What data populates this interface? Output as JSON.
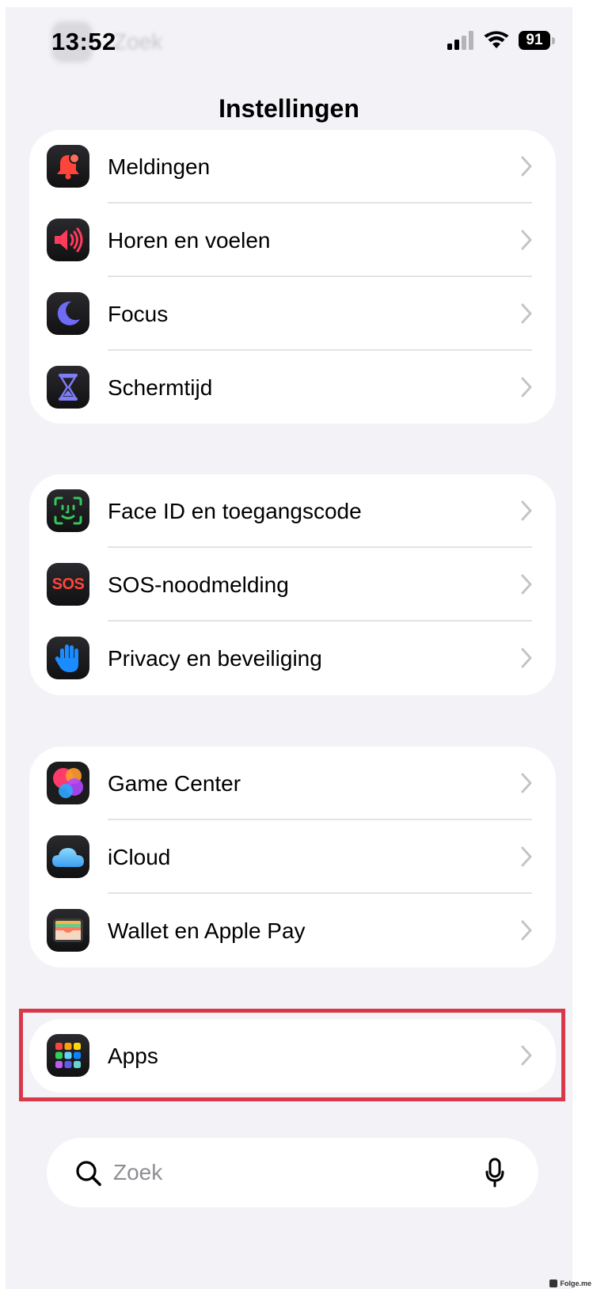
{
  "status_bar": {
    "time": "13:52",
    "battery": "91",
    "back_label": "Zoek"
  },
  "header": {
    "title": "Instellingen"
  },
  "groups": [
    {
      "items": [
        {
          "label": "Meldingen",
          "icon": "notification-bell-icon"
        },
        {
          "label": "Horen en voelen",
          "icon": "speaker-icon"
        },
        {
          "label": "Focus",
          "icon": "moon-icon"
        },
        {
          "label": "Schermtijd",
          "icon": "hourglass-icon"
        }
      ]
    },
    {
      "items": [
        {
          "label": "Face ID en toegangscode",
          "icon": "face-id-icon"
        },
        {
          "label": "SOS-noodmelding",
          "icon": "sos-icon",
          "icon_text": "SOS"
        },
        {
          "label": "Privacy en beveiliging",
          "icon": "hand-icon"
        }
      ]
    },
    {
      "items": [
        {
          "label": "Game Center",
          "icon": "game-center-icon"
        },
        {
          "label": "iCloud",
          "icon": "cloud-icon"
        },
        {
          "label": "Wallet en Apple Pay",
          "icon": "wallet-icon"
        }
      ]
    },
    {
      "items": [
        {
          "label": "Apps",
          "icon": "apps-grid-icon"
        }
      ]
    }
  ],
  "search": {
    "placeholder": "Zoek"
  },
  "watermark": "Folge.me",
  "colors": {
    "background": "#f2f2f7",
    "card": "#ffffff",
    "highlight": "#d8384a",
    "chevron": "#c4c4c7"
  }
}
